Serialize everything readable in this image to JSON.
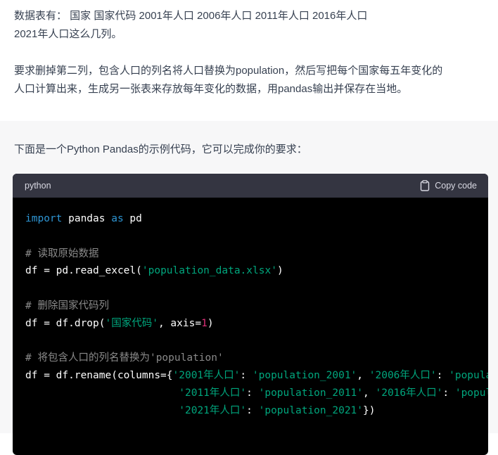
{
  "user": {
    "line1": "数据表有： 国家  国家代码   2001年人口    2006年人口    2011年人口    2016年人口",
    "line2": "2021年人口这么几列。",
    "line3": "要求删掉第二列，包含人口的列名将人口替换为population，然后写把每个国家每五年变化的",
    "line4": "人口计算出来，生成另一张表来存放每年变化的数据，用pandas输出并保存在当地。"
  },
  "assistant": {
    "intro": "下面是一个Python Pandas的示例代码，它可以完成你的要求：",
    "code_block": {
      "language": "python",
      "copy_label": "Copy code",
      "lines": {
        "l1": {
          "kw1": "import",
          "t1": " pandas ",
          "kw2": "as",
          "t2": " pd"
        },
        "l3": {
          "comment": "# 读取原始数据"
        },
        "l4": {
          "t1": "df = pd.read_excel(",
          "s1": "'population_data.xlsx'",
          "t2": ")"
        },
        "l6": {
          "comment": "# 删除国家代码列"
        },
        "l7": {
          "t1": "df = df.drop(",
          "s1": "'国家代码'",
          "t2": ", axis=",
          "n1": "1",
          "t3": ")"
        },
        "l9": {
          "comment": "# 将包含人口的列名替换为'population'"
        },
        "l10": {
          "t1": "df = df.rename(columns={",
          "s1": "'2001年人口'",
          "t2": ": ",
          "s2": "'population_2001'",
          "t3": ", ",
          "s3": "'2006年人口'",
          "t4": ": ",
          "s4": "'popula"
        },
        "l11": {
          "indent": "                         ",
          "s1": "'2011年人口'",
          "t1": ": ",
          "s2": "'population_2011'",
          "t2": ", ",
          "s3": "'2016年人口'",
          "t3": ": ",
          "s4": "'popula"
        },
        "l12": {
          "indent": "                         ",
          "s1": "'2021年人口'",
          "t1": ": ",
          "s2": "'population_2021'",
          "t2": "})"
        }
      }
    }
  },
  "colors": {
    "keyword": "#2e95d3",
    "string": "#00a67d",
    "number": "#df3079",
    "comment": "#8a8a8a",
    "code_bg": "#000000",
    "code_header_bg": "#343541",
    "assistant_bg": "#f7f7f8"
  },
  "icons": {
    "copy": "clipboard-icon"
  }
}
